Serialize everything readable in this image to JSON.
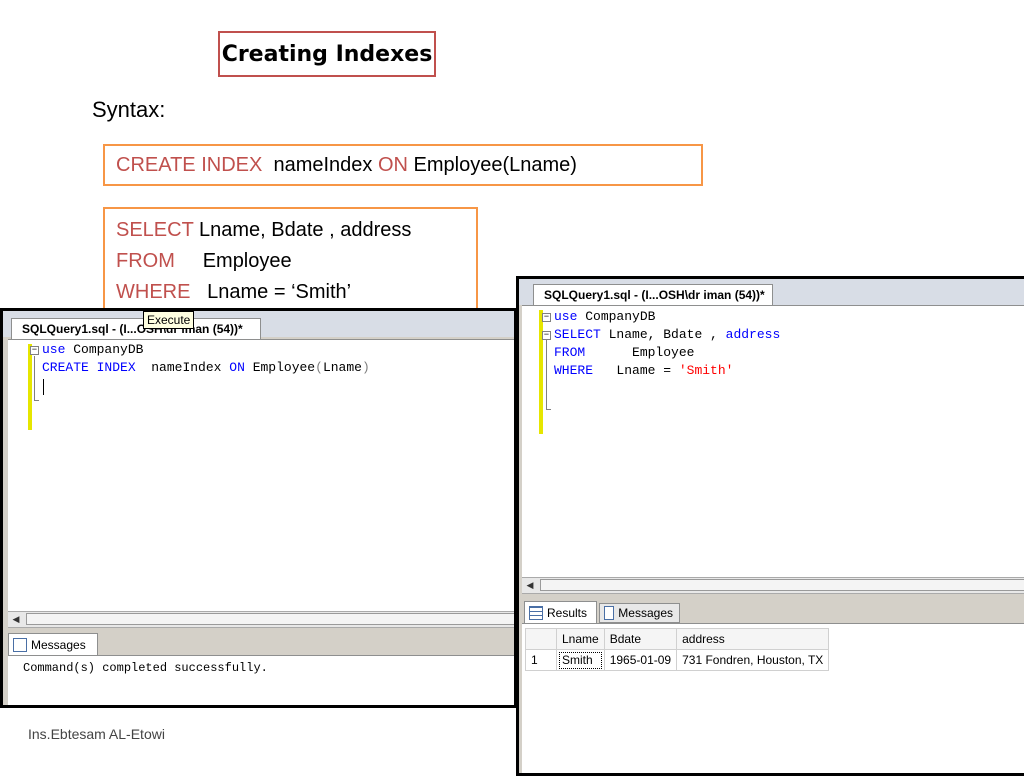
{
  "slide": {
    "title": "Creating Indexes",
    "syntax_label": "Syntax:",
    "create_stmt": {
      "kw1": "CREATE INDEX",
      "name": "nameIndex",
      "kw2": "ON",
      "target": "Employee(Lname)"
    },
    "select_stmt": [
      {
        "kw": "SELECT",
        "rest": "Lname, Bdate , address"
      },
      {
        "kw": "FROM",
        "rest": "Employee"
      },
      {
        "kw": "WHERE",
        "rest": "Lname = ‘Smith’"
      }
    ],
    "footer": "Ins.Ebtesam AL-Etowi"
  },
  "left_window": {
    "tab_title": "SQLQuery1.sql - (I...OSH\\dr iman (54))*",
    "tooltip": "Execute",
    "code": {
      "l1_kw": "use",
      "l1_rest": "CompanyDB",
      "l2_kw1": "CREATE",
      "l2_kw2": "INDEX",
      "l2_name": "nameIndex",
      "l2_kw3": "ON",
      "l2_table": "Employee",
      "l2_open": "(",
      "l2_col": "Lname",
      "l2_close": ")"
    },
    "messages_tab": "Messages",
    "message_text": "Command(s) completed successfully."
  },
  "right_window": {
    "tab_title": "SQLQuery1.sql - (I...OSH\\dr iman (54))*",
    "code": {
      "l1_kw": "use",
      "l1_rest": "CompanyDB",
      "l2_kw": "SELECT",
      "l2_rest": "Lname, Bdate ,",
      "l2_kw2": "address",
      "l3_kw": "FROM",
      "l3_rest": "Employee",
      "l4_kw": "WHERE",
      "l4_rest": "Lname =",
      "l4_str": "'Smith'"
    },
    "results_tab": "Results",
    "messages_tab": "Messages",
    "columns": [
      "Lname",
      "Bdate",
      "address"
    ],
    "rows": [
      {
        "num": "1",
        "Lname": "Smith",
        "Bdate": "1965-01-09",
        "address": "731 Fondren, Houston, TX"
      }
    ]
  },
  "colors": {
    "keyword_slide": "#c0504d",
    "title_border": "#c0504d",
    "box_border": "#f79646",
    "sql_keyword": "#0000ff",
    "sql_string": "#ff0000"
  }
}
